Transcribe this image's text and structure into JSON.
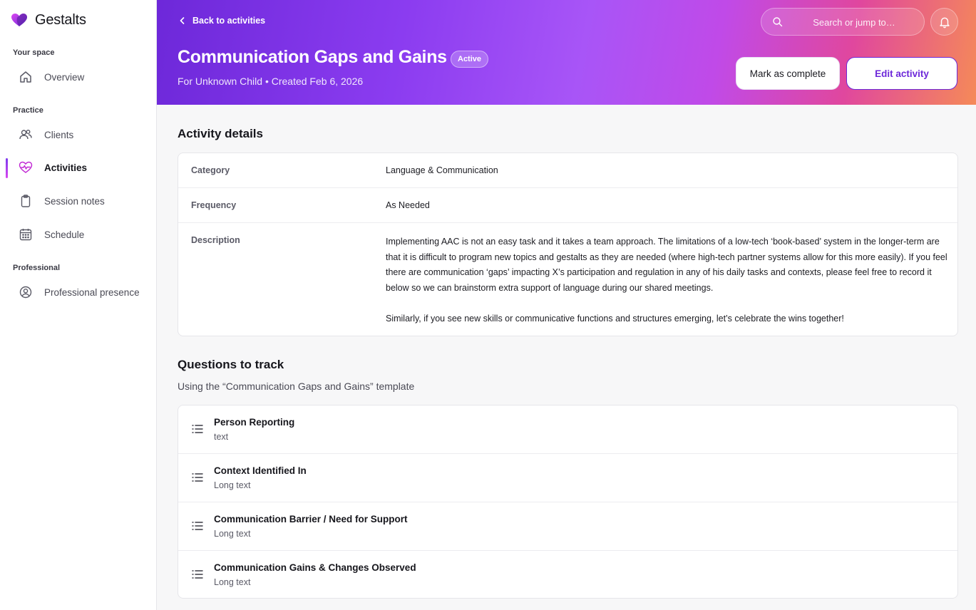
{
  "brand": {
    "name": "Gestalts"
  },
  "sidebar": {
    "sections": [
      {
        "label": "Your space"
      },
      {
        "label": "Practice"
      },
      {
        "label": "Professional"
      }
    ],
    "items": [
      {
        "label": "Overview",
        "icon": "home-icon"
      },
      {
        "label": "Clients",
        "icon": "users-icon"
      },
      {
        "label": "Activities",
        "icon": "heart-pulse-icon",
        "active": true
      },
      {
        "label": "Session notes",
        "icon": "clipboard-icon"
      },
      {
        "label": "Schedule",
        "icon": "calendar-icon"
      },
      {
        "label": "Professional presence",
        "icon": "user-circle-icon"
      }
    ]
  },
  "header": {
    "back_label": "Back to activities",
    "title": "Communication Gaps and Gains",
    "status": "Active",
    "subtitle": "For Unknown Child • Created Feb 6, 2026",
    "search_placeholder": "Search or jump to…",
    "mark_complete_label": "Mark as complete",
    "edit_label": "Edit activity"
  },
  "details": {
    "title": "Activity details",
    "rows": [
      {
        "label": "Category",
        "value": "Language & Communication"
      },
      {
        "label": "Frequency",
        "value": "As Needed"
      }
    ],
    "description_label": "Description",
    "description_p1": "Implementing AAC is not an easy task and it takes a team approach. The limitations of a low-tech ‘book-based’ system in the longer-term are that it is difficult to program new topics and gestalts as they are needed (where high-tech partner systems allow for this more easily). If you feel there are communication ‘gaps’ impacting X’s participation and regulation in any of his daily tasks and contexts, please feel free to record it below so we can brainstorm extra support of language during our shared meetings.",
    "description_p2": "Similarly, if you see new skills or communicative functions and structures emerging, let’s celebrate the wins together!"
  },
  "questions": {
    "title": "Questions to track",
    "template_note": "Using the “Communication Gaps and Gains” template",
    "items": [
      {
        "title": "Person Reporting",
        "type": "text"
      },
      {
        "title": "Context Identified In",
        "type": "Long text"
      },
      {
        "title": "Communication Barrier / Need for Support",
        "type": "Long text"
      },
      {
        "title": "Communication Gains & Changes Observed",
        "type": "Long text"
      }
    ]
  },
  "colors": {
    "accent": "#6d28d9",
    "header_gradient_start": "#6d28d9",
    "header_gradient_end": "#f58a58"
  }
}
